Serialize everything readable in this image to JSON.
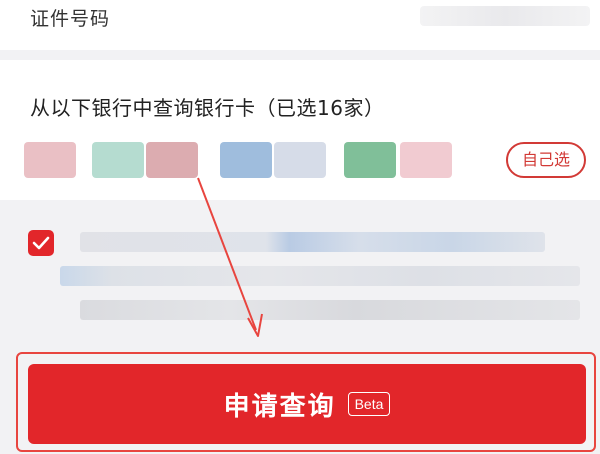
{
  "id_field": {
    "label": "证件号码"
  },
  "banks": {
    "heading": "从以下银行中查询银行卡（已选16家）",
    "self_select_label": "自己选",
    "logo_colors": [
      "#e7b6bc",
      "#a9d7c8",
      "#d79ea3",
      "#8fb2d8",
      "#cfd6e4",
      "#6ab488",
      "#efc3c9"
    ]
  },
  "agreement": {
    "checked": true
  },
  "apply": {
    "label": "申请查询",
    "badge": "Beta"
  },
  "colors": {
    "brand_red": "#e2262a",
    "annotation_red": "#e8453f"
  }
}
